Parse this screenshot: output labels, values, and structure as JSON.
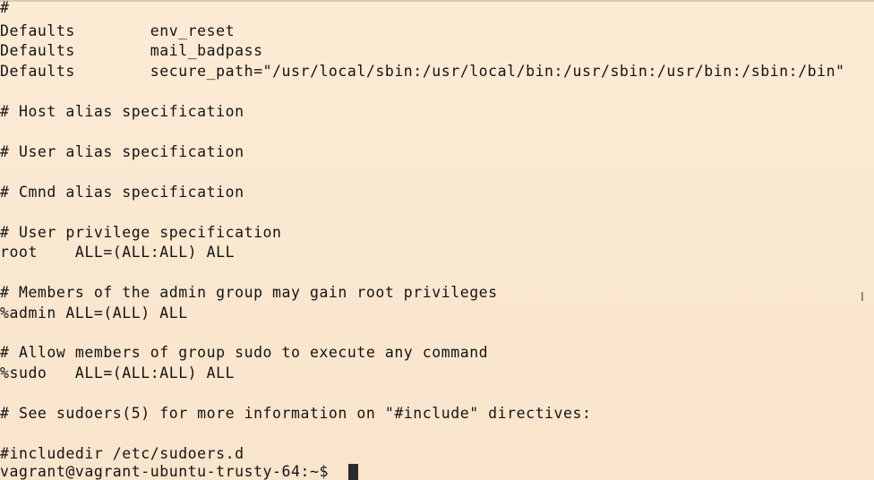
{
  "terminal": {
    "lines": [
      "#",
      "Defaults        env_reset",
      "Defaults        mail_badpass",
      "Defaults        secure_path=\"/usr/local/sbin:/usr/local/bin:/usr/sbin:/usr/bin:/sbin:/bin\"",
      "# Host alias specification",
      "# User alias specification",
      "# Cmnd alias specification",
      "# User privilege specification",
      "root    ALL=(ALL:ALL) ALL",
      "# Members of the admin group may gain root privileges",
      "%admin ALL=(ALL) ALL",
      "# Allow members of group sudo to execute any command",
      "%sudo   ALL=(ALL:ALL) ALL",
      "# See sudoers(5) for more information on \"#include\" directives:",
      "#includedir /etc/sudoers.d"
    ],
    "prompt": "vagrant@vagrant-ubuntu-trusty-64:~$",
    "cursor_icon": "block-cursor-icon",
    "mouse_icon": "text-ibeam-cursor-icon",
    "colors": {
      "background": "#fbe9d2",
      "text": "#141414"
    }
  }
}
